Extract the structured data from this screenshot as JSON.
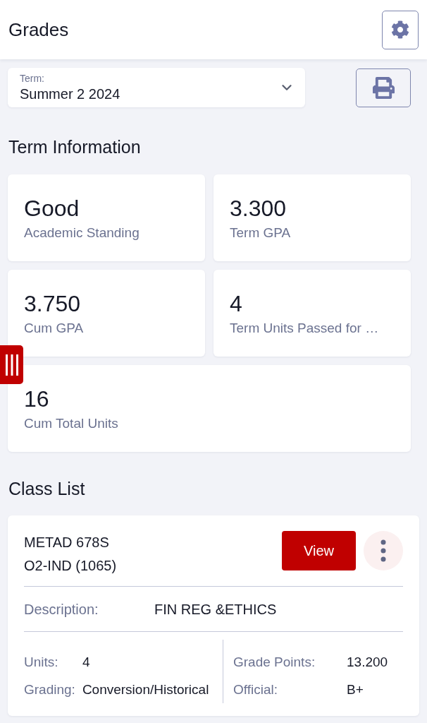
{
  "header": {
    "title": "Grades"
  },
  "term_select": {
    "label": "Term:",
    "value": "Summer 2 2024"
  },
  "term_information": {
    "heading": "Term Information",
    "cards": [
      {
        "value": "Good",
        "label": "Academic Standing"
      },
      {
        "value": "3.300",
        "label": "Term GPA"
      },
      {
        "value": "3.750",
        "label": "Cum GPA"
      },
      {
        "value": "4",
        "label": "Term Units Passed for …"
      },
      {
        "value": "16",
        "label": "Cum Total Units"
      }
    ]
  },
  "class_list": {
    "heading": "Class List",
    "classes": [
      {
        "course": "METAD 678S",
        "section": "O2-IND (1065)",
        "view_button": "View",
        "description_label": "Description:",
        "description": "FIN REG &ETHICS",
        "fields_left": [
          {
            "label": "Units:",
            "value": "4"
          },
          {
            "label": "Grading:",
            "value": "Conversion/Historical"
          }
        ],
        "fields_right": [
          {
            "label": "Grade Points:",
            "value": "13.200"
          },
          {
            "label": "Official:",
            "value": "B+"
          }
        ]
      }
    ]
  }
}
